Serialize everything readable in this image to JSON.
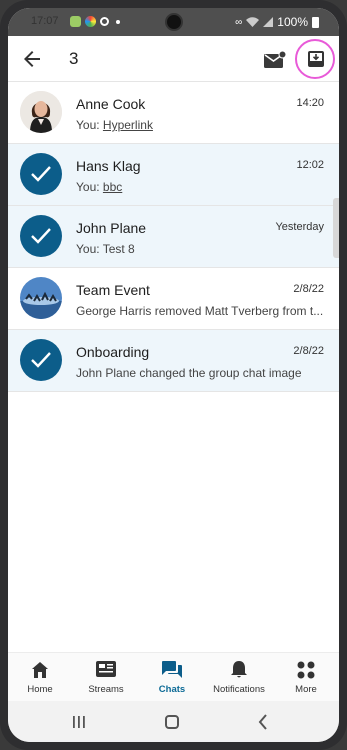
{
  "status_bar": {
    "time": "17:07",
    "battery": "100%"
  },
  "header": {
    "selected_count": "3"
  },
  "chats": [
    {
      "name": "Anne Cook",
      "time": "14:20",
      "preview_prefix": "You: ",
      "preview_link": "Hyperlink",
      "selected": false,
      "avatar": "photo"
    },
    {
      "name": "Hans Klag",
      "time": "12:02",
      "preview_prefix": "You: ",
      "preview_link": "bbc",
      "selected": true,
      "avatar": "check"
    },
    {
      "name": "John Plane",
      "time": "Yesterday",
      "preview_prefix": "You: Test 8",
      "preview_link": "",
      "selected": true,
      "avatar": "check"
    },
    {
      "name": "Team Event",
      "time": "2/8/22",
      "preview_prefix": "George Harris removed Matt Tverberg from t...",
      "preview_link": "",
      "selected": false,
      "avatar": "group-photo"
    },
    {
      "name": "Onboarding",
      "time": "2/8/22",
      "preview_prefix": "John Plane changed the group chat image",
      "preview_link": "",
      "selected": true,
      "avatar": "check"
    }
  ],
  "nav": [
    {
      "label": "Home",
      "icon": "home-icon",
      "active": false
    },
    {
      "label": "Streams",
      "icon": "streams-icon",
      "active": false
    },
    {
      "label": "Chats",
      "icon": "chats-icon",
      "active": true
    },
    {
      "label": "Notifications",
      "icon": "bell-icon",
      "active": false
    },
    {
      "label": "More",
      "icon": "grid-icon",
      "active": false
    }
  ],
  "colors": {
    "accent": "#0c5d8a",
    "selected_row": "#eef6fb",
    "highlight_ring": "#e85ad8"
  }
}
